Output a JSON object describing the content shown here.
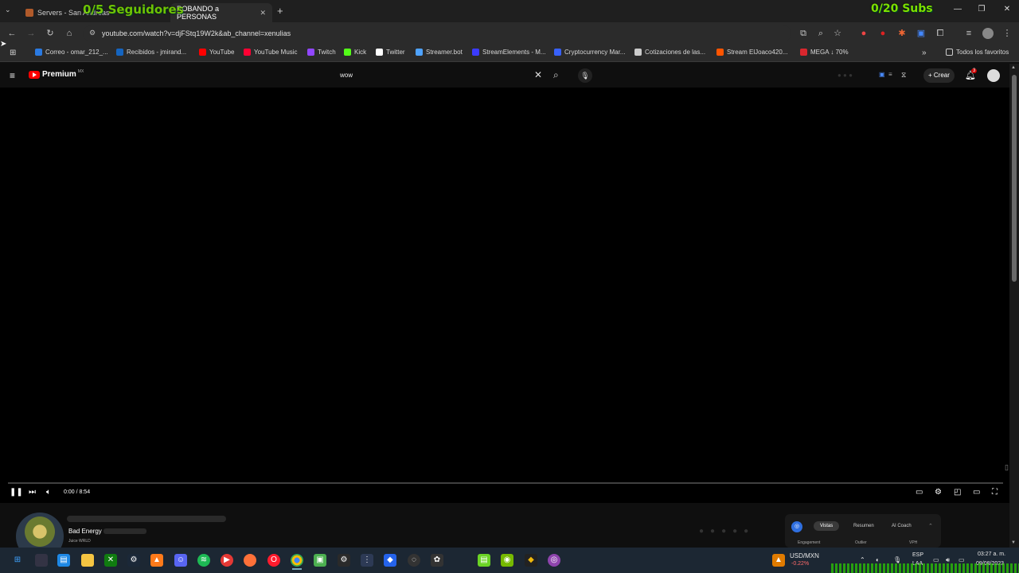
{
  "browser": {
    "tabs": [
      {
        "title": "Servers - San Andreas"
      },
      {
        "title": "ROBANDO a PERSONAS"
      }
    ],
    "new_tab": "+",
    "url": "youtube.com/watch?v=djFStq19W2k&ab_channel=xenulias",
    "bookmarks": [
      {
        "label": "Correo - omar_212_...",
        "color": "#2a7ae2"
      },
      {
        "label": "Recibidos - jmirand...",
        "color": "#1565c0"
      },
      {
        "label": "YouTube",
        "color": "#ff0000"
      },
      {
        "label": "YouTube Music",
        "color": "#ff0033"
      },
      {
        "label": "Twitch",
        "color": "#9146ff"
      },
      {
        "label": "Kick",
        "color": "#53fc18"
      },
      {
        "label": "Twitter",
        "color": "#ffffff"
      },
      {
        "label": "Streamer.bot",
        "color": "#4fa3ff"
      },
      {
        "label": "StreamElements - M...",
        "color": "#3b3bff"
      },
      {
        "label": "Cryptocurrency Mar...",
        "color": "#3861fb"
      },
      {
        "label": "Cotizaciones de las...",
        "color": "#cccccc"
      },
      {
        "label": "Stream ElJoaco420...",
        "color": "#ff5500"
      },
      {
        "label": "MEGA ↓ 70%",
        "color": "#d9272e"
      }
    ],
    "all_bookmarks": "Todos los favoritos",
    "overlay_top": "0/5 Seguidores",
    "overlay_subs": "0/20 Subs"
  },
  "youtube": {
    "brand": "Premium",
    "country": "MX",
    "search_value": "wow",
    "create_label": "Crear",
    "notif_count": "3",
    "time_display": "0:00 / 8:54"
  },
  "below": {
    "song_title": "Bad Energy",
    "artist": "Juice WRLD",
    "tabs": [
      "Vistas",
      "Resumen",
      "AI Coach"
    ],
    "sub_labels": [
      "Engagement",
      "Outlier",
      "VPH"
    ]
  },
  "taskbar": {
    "currency": "USD/MXN",
    "currency_change": "-0.22%",
    "lang_top": "ESP",
    "lang_bottom": "LAA",
    "time": "03:27 a. m.",
    "date": "09/08/2023"
  },
  "colors": {
    "accent_green": "#7ee000",
    "youtube_red": "#ff0000"
  }
}
